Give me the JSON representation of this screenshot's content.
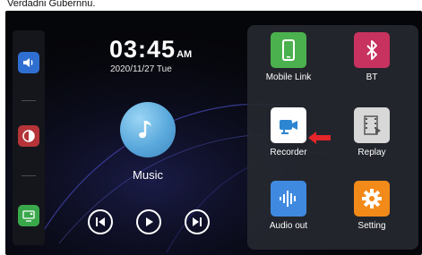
{
  "caption": {
    "text": "Verdadni Gubernnu."
  },
  "clock": {
    "time": "03:45",
    "ampm": "AM",
    "date": "2020/11/27  Tue"
  },
  "music": {
    "label": "Music"
  },
  "sidebar": {
    "items": [
      {
        "icon": "volume-icon",
        "color": "#2f6fd1"
      },
      {
        "icon": "brightness-icon",
        "color": "#b4343a"
      },
      {
        "icon": "screen-cast-icon",
        "color": "#39a84a"
      }
    ]
  },
  "apps": [
    {
      "label": "Mobile Link",
      "icon": "mobile-link-icon",
      "color": "#4bb14e"
    },
    {
      "label": "BT",
      "icon": "bluetooth-icon",
      "color": "#c8325e"
    },
    {
      "label": "Recorder",
      "icon": "recorder-icon",
      "color": "#ffffff"
    },
    {
      "label": "Replay",
      "icon": "replay-icon",
      "color": "#d8d8d8"
    },
    {
      "label": "Audio out",
      "icon": "audio-out-icon",
      "color": "#3f8ae0"
    },
    {
      "label": "Setting",
      "icon": "settings-icon",
      "color": "#f28a1a"
    }
  ],
  "colors": {
    "background": "#050609",
    "panel": "#26282f",
    "highlight_arrow": "#e3262b",
    "accent_glow": "#3e3fa5"
  }
}
